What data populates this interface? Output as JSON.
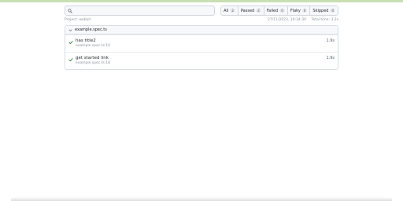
{
  "search": {
    "placeholder": "",
    "value": ""
  },
  "filters": [
    {
      "label": "All",
      "count": "2"
    },
    {
      "label": "Passed",
      "count": "2"
    },
    {
      "label": "Failed",
      "count": "0"
    },
    {
      "label": "Flaky",
      "count": "0"
    },
    {
      "label": "Skipped",
      "count": "0"
    }
  ],
  "meta": {
    "project": "Project: webkit",
    "datetime": "27/11/2023, 19:34:30",
    "total_time": "Total time: 3.2s"
  },
  "file": {
    "name": "example.spec.ts",
    "tests": [
      {
        "status": "passed",
        "title": "has title2",
        "location": "example.spec.ts:10",
        "duration": "1.9s"
      },
      {
        "status": "passed",
        "title": "get started link",
        "location": "example.spec.ts:18",
        "duration": "1.9s"
      }
    ]
  },
  "colors": {
    "accent_bar": "#c9dfb4",
    "passed": "#1a7f37"
  },
  "icons": {
    "search": "search-icon",
    "expand": "chevron-down-icon",
    "status": "check-icon"
  }
}
